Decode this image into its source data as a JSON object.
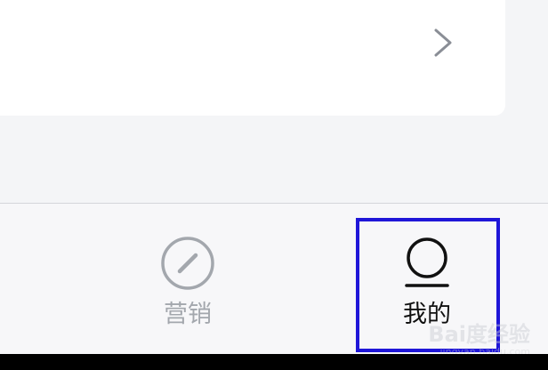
{
  "card": {
    "chevron_icon": "chevron-right-icon"
  },
  "tabbar": {
    "tabs": [
      {
        "label": "营销",
        "icon": "compass-icon",
        "active": false
      },
      {
        "label": "我的",
        "icon": "user-icon",
        "active": true
      }
    ]
  },
  "watermark": {
    "logo": "Bai度经验",
    "url": "jingyan.baidu.com"
  },
  "colors": {
    "background": "#f4f5f7",
    "card": "#ffffff",
    "inactive": "#a3a7ad",
    "active": "#111111",
    "highlight": "#1f16d8"
  }
}
